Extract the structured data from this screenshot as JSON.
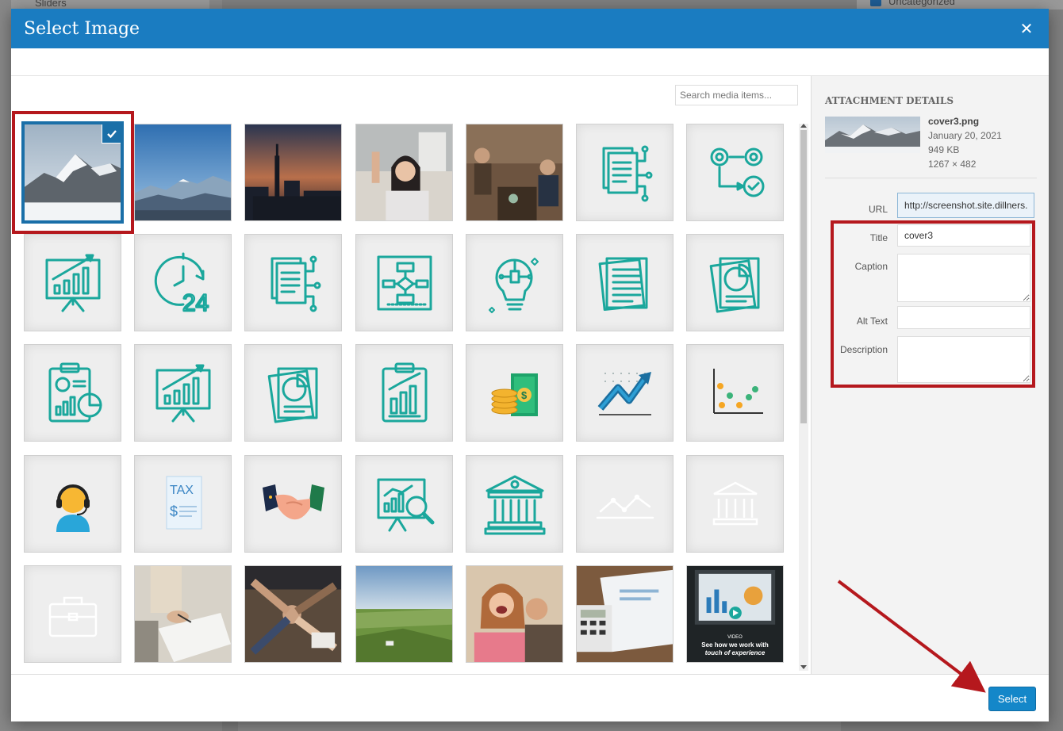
{
  "background": {
    "left_item": "Sliders",
    "right_item": "Uncategorized"
  },
  "modal": {
    "title": "Select Image",
    "close_icon": "close-icon"
  },
  "search": {
    "placeholder": "Search media items..."
  },
  "media_items": [
    {
      "kind": "photo",
      "name": "cover3-mountain",
      "selected": true
    },
    {
      "kind": "photo",
      "name": "blue-mountains"
    },
    {
      "kind": "photo",
      "name": "city-sunset"
    },
    {
      "kind": "photo",
      "name": "woman-raising-hand"
    },
    {
      "kind": "photo",
      "name": "people-in-cafe"
    },
    {
      "kind": "icon",
      "name": "document-flow-icon"
    },
    {
      "kind": "icon",
      "name": "gears-flow-icon"
    },
    {
      "kind": "icon",
      "name": "growth-chart-board-icon"
    },
    {
      "kind": "icon",
      "name": "clock-24-icon"
    },
    {
      "kind": "icon",
      "name": "document-flow-icon"
    },
    {
      "kind": "icon",
      "name": "flowchart-board-icon"
    },
    {
      "kind": "icon",
      "name": "lightbulb-circuit-icon"
    },
    {
      "kind": "icon",
      "name": "documents-stack-icon"
    },
    {
      "kind": "icon",
      "name": "pie-chart-documents-icon"
    },
    {
      "kind": "icon",
      "name": "clipboard-report-icon"
    },
    {
      "kind": "icon",
      "name": "growth-chart-board-icon"
    },
    {
      "kind": "icon",
      "name": "pie-chart-documents-icon"
    },
    {
      "kind": "icon",
      "name": "clipboard-bar-chart-icon"
    },
    {
      "kind": "icon",
      "name": "coins-money-icon"
    },
    {
      "kind": "icon",
      "name": "trend-arrow-icon"
    },
    {
      "kind": "icon",
      "name": "scatter-plot-icon"
    },
    {
      "kind": "icon",
      "name": "support-agent-icon"
    },
    {
      "kind": "icon",
      "name": "tax-document-icon",
      "label": "TAX"
    },
    {
      "kind": "icon",
      "name": "handshake-icon"
    },
    {
      "kind": "icon",
      "name": "analysis-board-icon"
    },
    {
      "kind": "icon",
      "name": "bank-building-icon"
    },
    {
      "kind": "icon",
      "name": "line-graph-white-icon"
    },
    {
      "kind": "icon",
      "name": "bank-white-icon"
    },
    {
      "kind": "icon",
      "name": "briefcase-white-icon"
    },
    {
      "kind": "photo",
      "name": "signing-documents"
    },
    {
      "kind": "photo",
      "name": "team-fist-bump"
    },
    {
      "kind": "photo",
      "name": "green-farmland"
    },
    {
      "kind": "photo",
      "name": "happy-couple"
    },
    {
      "kind": "photo",
      "name": "calculator-paperwork"
    },
    {
      "kind": "photo",
      "name": "video-thumbnail",
      "caption_small": "VIDEO",
      "caption": "See how we work with",
      "caption2": "touch of experience"
    }
  ],
  "attachment": {
    "heading": "Attachment Details",
    "filename": "cover3.png",
    "date": "January 20, 2021",
    "size": "949 KB",
    "dimensions": "1267 × 482"
  },
  "fields": {
    "url_label": "URL",
    "url_value": "http://screenshot.site.dillners.",
    "title_label": "Title",
    "title_value": "cover3",
    "caption_label": "Caption",
    "caption_value": "",
    "alt_label": "Alt Text",
    "alt_value": "",
    "description_label": "Description",
    "description_value": ""
  },
  "footer": {
    "select_label": "Select"
  },
  "colors": {
    "header_blue": "#1a7cc1",
    "icon_teal": "#1aa79c",
    "annotation_red": "#b5181d",
    "button_blue": "#1487c9"
  }
}
